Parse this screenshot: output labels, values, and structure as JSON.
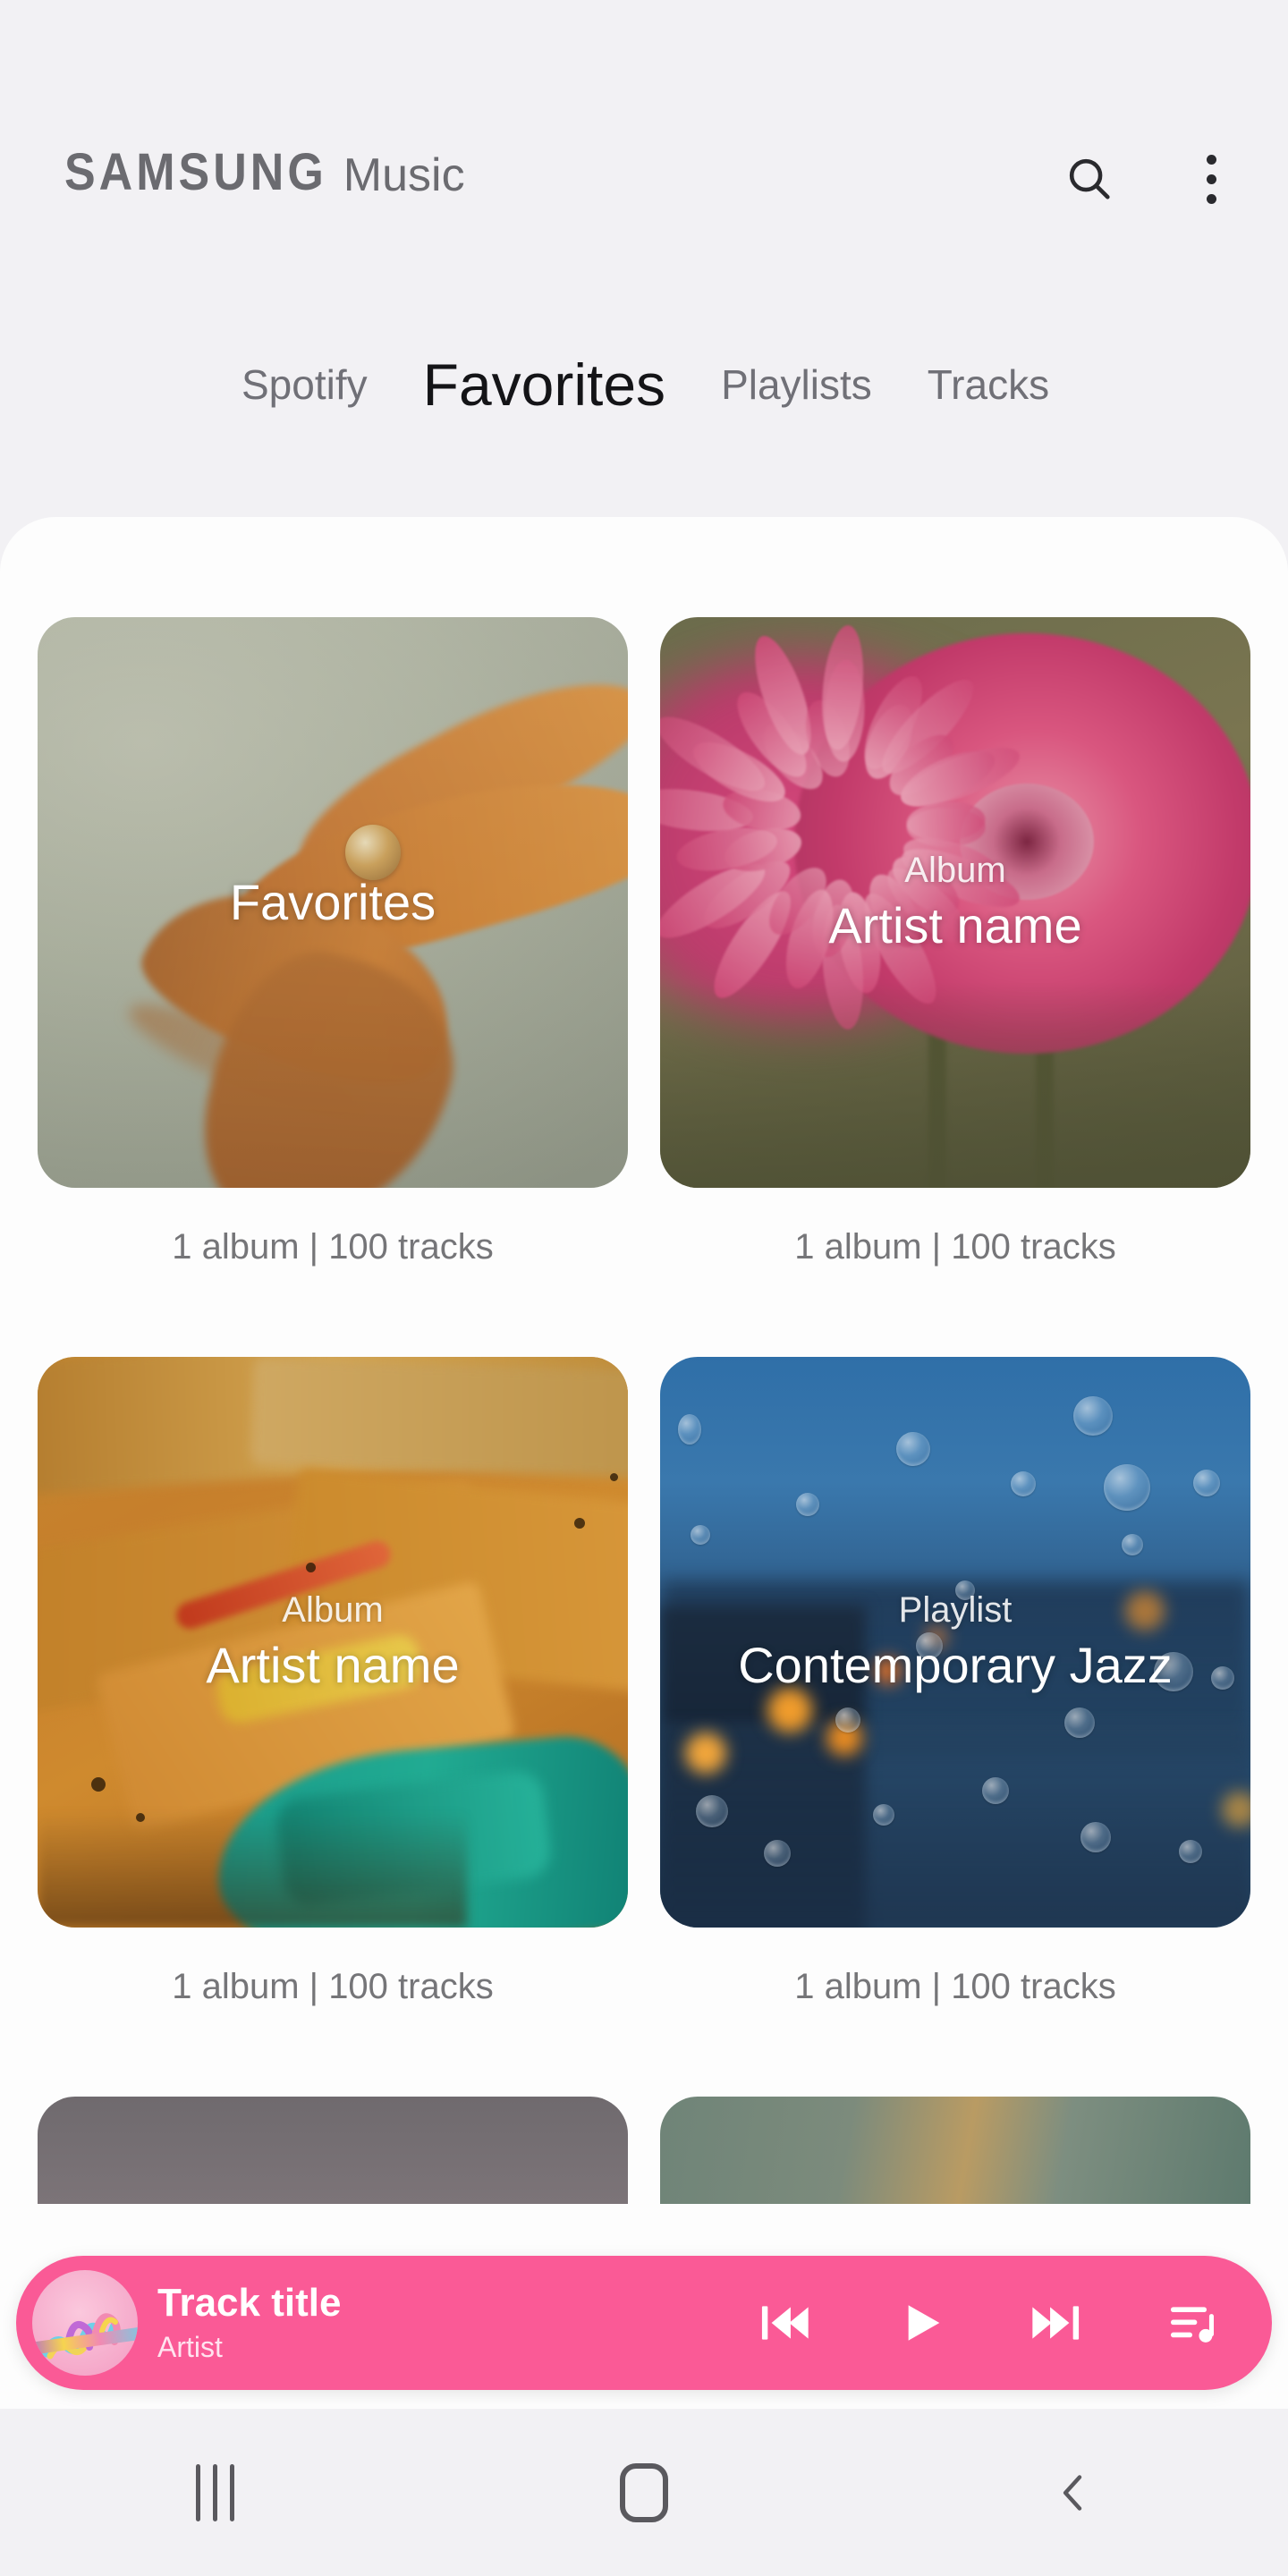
{
  "app": {
    "brand_samsung": "SAMSUNG",
    "brand_app": "Music"
  },
  "header": {
    "search_icon": "search-icon",
    "overflow_icon": "more-vertical-icon"
  },
  "tabs": [
    {
      "label": "Spotify",
      "active": false
    },
    {
      "label": "Favorites",
      "active": true
    },
    {
      "label": "Playlists",
      "active": false
    },
    {
      "label": "Tracks",
      "active": false
    }
  ],
  "cards": [
    {
      "kind": "",
      "title": "Favorites",
      "albums": "1 album",
      "separator": "|",
      "tracks": "100 tracks",
      "meta": "1 album  | 100 tracks",
      "artwork": "orange-petal-waterdrop"
    },
    {
      "kind": "Album",
      "title": "Artist name",
      "albums": "1 album",
      "separator": "|",
      "tracks": "100 tracks",
      "meta": "1 album  | 100 tracks",
      "artwork": "pink-chrysanthemum"
    },
    {
      "kind": "Album",
      "title": "Artist name",
      "albums": "1 album",
      "separator": "|",
      "tracks": "100 tracks",
      "meta": "1 album  | 100 tracks",
      "artwork": "abstract-oil-painting"
    },
    {
      "kind": "Playlist",
      "title": "Contemporary Jazz",
      "albums": "1 album",
      "separator": "|",
      "tracks": "100 tracks",
      "meta": "1 album  | 100 tracks",
      "artwork": "rainy-window-city-bokeh"
    }
  ],
  "player": {
    "track_title": "Track title",
    "artist": "Artist",
    "thumbnail": "colorful-paper-ribbons",
    "controls": {
      "previous": "skip-previous-icon",
      "play": "play-icon",
      "next": "skip-next-icon",
      "queue": "playlist-queue-icon"
    },
    "accent_color": "#FA5A96"
  },
  "navbar": {
    "recents": "recents-icon",
    "home": "home-icon",
    "back": "back-icon"
  },
  "colors": {
    "page_background": "#F2F1F4",
    "panel_background": "#FDFDFD",
    "accent_pink": "#FA5A96",
    "text_primary": "#141417",
    "text_secondary": "#707077",
    "meta_gray": "#757578"
  }
}
